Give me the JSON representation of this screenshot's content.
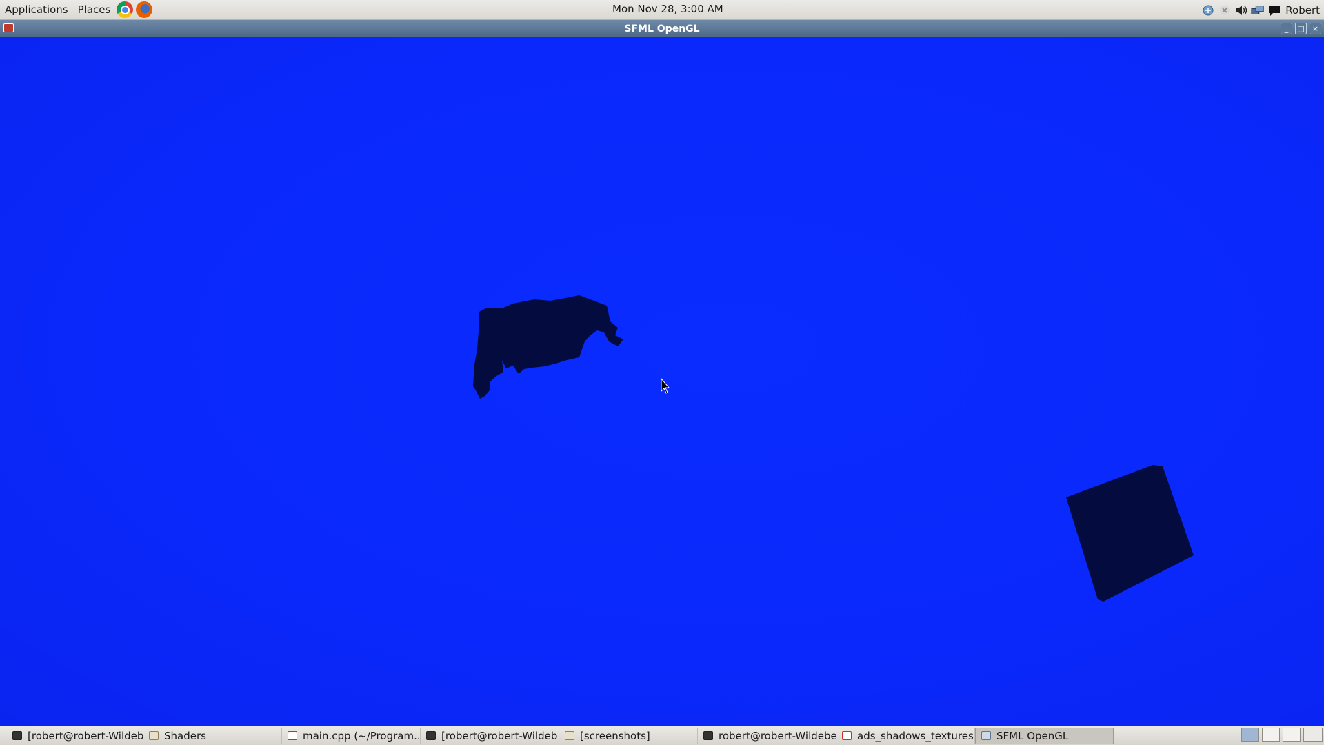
{
  "top_panel": {
    "applications_label": "Applications",
    "places_label": "Places",
    "launchers": [
      "chrome-icon",
      "firefox-icon"
    ],
    "clock": "Mon Nov 28,  3:00 AM",
    "tray_icons": [
      "network-icon",
      "close-tray-icon",
      "volume-icon",
      "display-icon",
      "chat-icon"
    ],
    "user": "Robert"
  },
  "window": {
    "title": "SFML OpenGL",
    "controls": [
      "minimize",
      "maximize",
      "close"
    ],
    "background_color": "#0a28fb",
    "object_color": "#040b3f"
  },
  "taskbar": {
    "tasks": [
      {
        "label": "[robert@robert-Wildeb...",
        "icon": "terminal-icon",
        "active": false
      },
      {
        "label": "Shaders",
        "icon": "folder-icon",
        "active": false
      },
      {
        "label": "main.cpp (~/Program...",
        "icon": "edit-icon",
        "active": false
      },
      {
        "label": "[robert@robert-Wildeb...",
        "icon": "terminal-icon",
        "active": false
      },
      {
        "label": "[screenshots]",
        "icon": "folder-icon",
        "active": false
      },
      {
        "label": "robert@robert-Wildebe...",
        "icon": "terminal-icon",
        "active": false
      },
      {
        "label": "ads_shadows_textures...",
        "icon": "edit-icon",
        "active": false
      },
      {
        "label": "SFML OpenGL",
        "icon": "window-icon",
        "active": true
      }
    ]
  }
}
